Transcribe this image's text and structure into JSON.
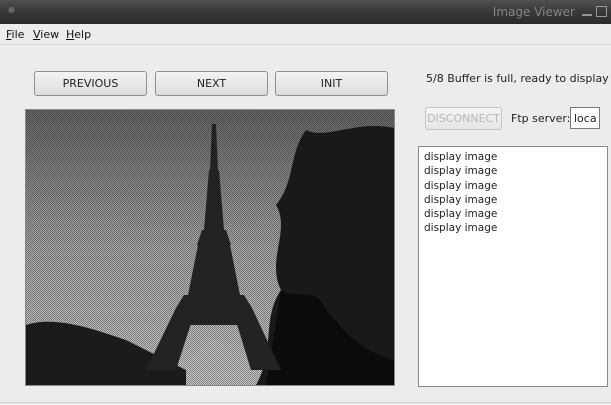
{
  "window": {
    "title": "Image Viewer"
  },
  "menu": [
    {
      "label": "File",
      "mnemonic": "F",
      "rest": "ile"
    },
    {
      "label": "View",
      "mnemonic": "V",
      "rest": "iew"
    },
    {
      "label": "Help",
      "mnemonic": "H",
      "rest": "elp"
    }
  ],
  "toolbar": {
    "previous_label": "PREVIOUS",
    "next_label": "NEXT",
    "init_label": "INIT"
  },
  "status": {
    "text": "5/8 Buffer is full, ready to display"
  },
  "connection": {
    "disconnect_label": "DISCONNECT",
    "disconnect_enabled": false,
    "ftp_label": "Ftp server:",
    "ftp_value": "local"
  },
  "log": {
    "lines": [
      "display image",
      "display image",
      "display image",
      "display image",
      "display image",
      "display image"
    ]
  },
  "image": {
    "subject": "eiffel-tower-photo"
  },
  "colors": {
    "titlebar": "#3a3a3a",
    "background": "#ececec",
    "disabled_text": "#b7b7b7"
  }
}
